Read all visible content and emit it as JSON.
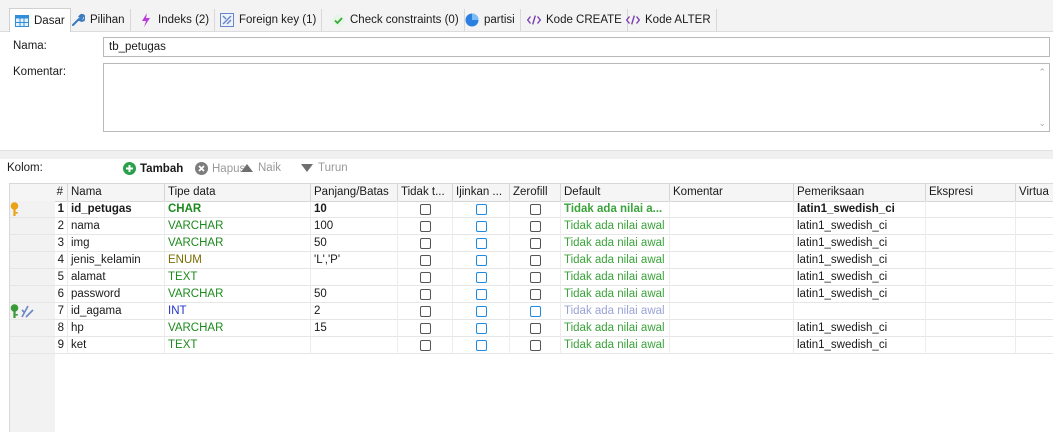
{
  "tabs": [
    {
      "label": "Dasar",
      "icon": "table-icon",
      "color": "#2f8fd8"
    },
    {
      "label": "Pilihan",
      "icon": "wrench-icon",
      "color": "#3b7bbf"
    },
    {
      "label": "Indeks (2)",
      "icon": "lightning-icon",
      "color": "#b83bd8"
    },
    {
      "label": "Foreign key (1)",
      "icon": "foreign-key-icon",
      "color": "#6a86c8"
    },
    {
      "label": "Check constraints (0)",
      "icon": "checkmark-icon",
      "color": "#3aa83a"
    },
    {
      "label": "partisi",
      "icon": "pie-icon",
      "color": "#2a7fe0"
    },
    {
      "label": "Kode CREATE",
      "icon": "code-icon",
      "color": "#7b3fb0"
    },
    {
      "label": "Kode ALTER",
      "icon": "code-icon",
      "color": "#7b3fb0"
    }
  ],
  "form": {
    "name_label": "Nama:",
    "name_value": "tb_petugas",
    "comment_label": "Komentar:",
    "comment_value": ""
  },
  "toolbar": {
    "columns_label": "Kolom:",
    "add": "Tambah",
    "remove": "Hapus",
    "up": "Naik",
    "down": "Turun"
  },
  "grid": {
    "headers": [
      "#",
      "Nama",
      "Tipe data",
      "Panjang/Batas",
      "Tidak t...",
      "Ijinkan ...",
      "Zerofill",
      "Default",
      "Komentar",
      "Pemeriksaan",
      "Ekspresi",
      "Virtua"
    ],
    "rows": [
      {
        "num": "1",
        "name": "id_petugas",
        "type": "CHAR",
        "length": "10",
        "unsigned": false,
        "nullable": false,
        "zerofill": false,
        "default": "Tidak ada nilai a...",
        "comment": "",
        "collation": "latin1_swedish_ci",
        "key": "primary",
        "bold": true,
        "type_style": "text"
      },
      {
        "num": "2",
        "name": "nama",
        "type": "VARCHAR",
        "length": "100",
        "unsigned": false,
        "nullable": false,
        "zerofill": false,
        "default": "Tidak ada nilai awal",
        "comment": "",
        "collation": "latin1_swedish_ci",
        "key": "",
        "bold": false,
        "type_style": "text"
      },
      {
        "num": "3",
        "name": "img",
        "type": "VARCHAR",
        "length": "50",
        "unsigned": false,
        "nullable": false,
        "zerofill": false,
        "default": "Tidak ada nilai awal",
        "comment": "",
        "collation": "latin1_swedish_ci",
        "key": "",
        "bold": false,
        "type_style": "text"
      },
      {
        "num": "4",
        "name": "jenis_kelamin",
        "type": "ENUM",
        "length": "'L','P'",
        "unsigned": false,
        "nullable": false,
        "zerofill": false,
        "default": "Tidak ada nilai awal",
        "comment": "",
        "collation": "latin1_swedish_ci",
        "key": "",
        "bold": false,
        "type_style": "enum"
      },
      {
        "num": "5",
        "name": "alamat",
        "type": "TEXT",
        "length": "",
        "unsigned": false,
        "nullable": false,
        "zerofill": false,
        "default": "Tidak ada nilai awal",
        "comment": "",
        "collation": "latin1_swedish_ci",
        "key": "",
        "bold": false,
        "type_style": "text"
      },
      {
        "num": "6",
        "name": "password",
        "type": "VARCHAR",
        "length": "50",
        "unsigned": false,
        "nullable": false,
        "zerofill": false,
        "default": "Tidak ada nilai awal",
        "comment": "",
        "collation": "latin1_swedish_ci",
        "key": "",
        "bold": false,
        "type_style": "text"
      },
      {
        "num": "7",
        "name": "id_agama",
        "type": "INT",
        "length": "2",
        "unsigned": false,
        "nullable": false,
        "zerofill": false,
        "default": "Tidak ada nilai awal",
        "comment": "",
        "collation": "",
        "key": "index-foreign",
        "bold": false,
        "type_style": "int"
      },
      {
        "num": "8",
        "name": "hp",
        "type": "VARCHAR",
        "length": "15",
        "unsigned": false,
        "nullable": false,
        "zerofill": false,
        "default": "Tidak ada nilai awal",
        "comment": "",
        "collation": "latin1_swedish_ci",
        "key": "",
        "bold": false,
        "type_style": "text"
      },
      {
        "num": "9",
        "name": "ket",
        "type": "TEXT",
        "length": "",
        "unsigned": false,
        "nullable": false,
        "zerofill": false,
        "default": "Tidak ada nilai awal",
        "comment": "",
        "collation": "latin1_swedish_ci",
        "key": "",
        "bold": false,
        "type_style": "text"
      }
    ]
  },
  "colors": {
    "type_text": "#1c8a1c",
    "type_int": "#2233c8",
    "type_enum": "#7a6e00",
    "default_text": "#3aa33a",
    "primary_key": "#e8a317",
    "foreign_key": "#3a9a3a",
    "checkbox_blue": "#1e8be0"
  }
}
